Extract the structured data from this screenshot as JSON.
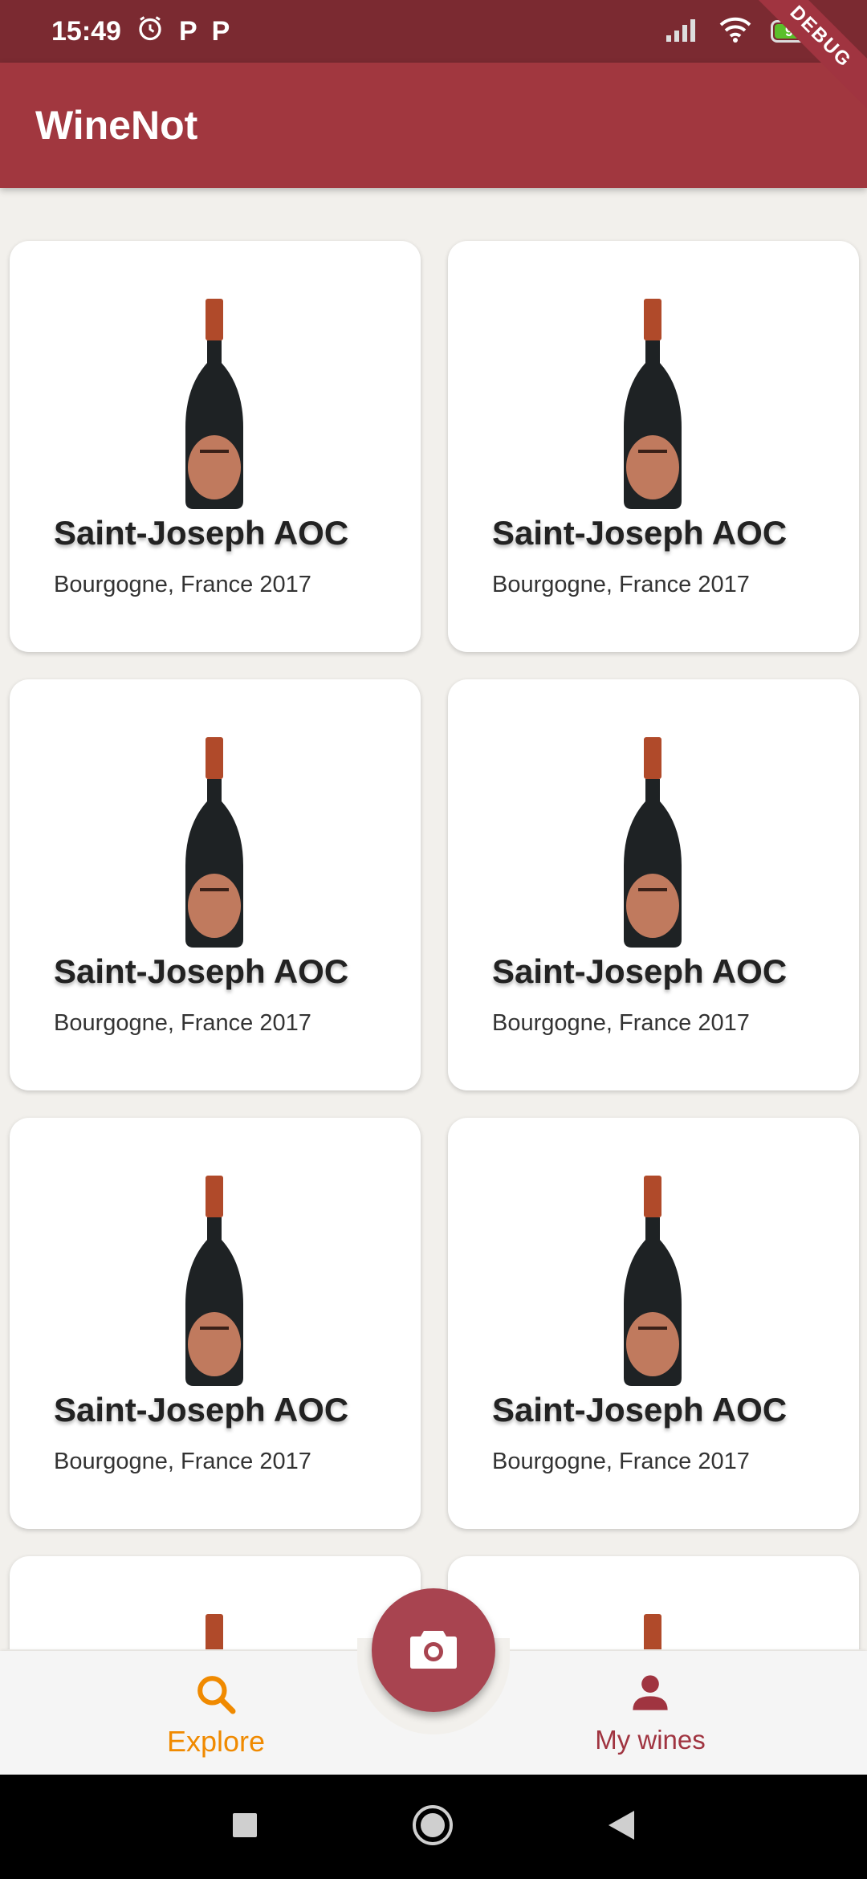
{
  "status_bar": {
    "time": "15:49",
    "battery": "90",
    "debug_label": "DEBUG"
  },
  "app": {
    "title": "WineNot"
  },
  "wines": [
    {
      "name": "Saint-Joseph AOC",
      "origin": "Bourgogne, France 2017"
    },
    {
      "name": "Saint-Joseph AOC",
      "origin": "Bourgogne, France 2017"
    },
    {
      "name": "Saint-Joseph AOC",
      "origin": "Bourgogne, France 2017"
    },
    {
      "name": "Saint-Joseph AOC",
      "origin": "Bourgogne, France 2017"
    },
    {
      "name": "Saint-Joseph AOC",
      "origin": "Bourgogne, France 2017"
    },
    {
      "name": "Saint-Joseph AOC",
      "origin": "Bourgogne, France 2017"
    }
  ],
  "bottom_nav": {
    "explore_label": "Explore",
    "mywines_label": "My wines"
  },
  "colors": {
    "primary": "#a1373f",
    "status_bar": "#7b2a31",
    "accent_active": "#f08a00",
    "fab": "#a84450"
  }
}
